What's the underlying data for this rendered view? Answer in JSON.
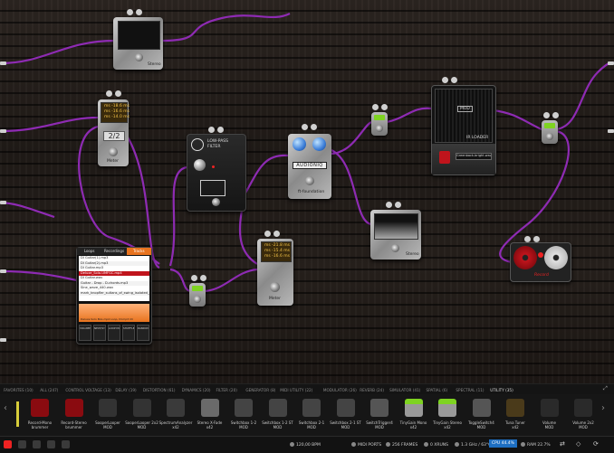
{
  "pedals": {
    "stereo_analyzer_top": {
      "label": "Stereo"
    },
    "metronome_left": {
      "rows": [
        "ms -18.6 ms",
        "ms -16.6 ms",
        "ms -14.0 ms"
      ],
      "big": "2/2",
      "label": "Meter"
    },
    "lowpass": {
      "title_1": "LOW-PASS",
      "title_2": "FILTER",
      "brand": "LPF"
    },
    "fuzz": {
      "label": "AUDIONIQ",
      "sub": "ft-foundation"
    },
    "ir_loader": {
      "brand": "MOD",
      "title": "IR LOADER",
      "file": "Greenback-bright.wav"
    },
    "spectrum_mid": {
      "label": "Stereo"
    },
    "metronome_mid": {
      "rows": [
        "ms -21.8 ms",
        "ms -15.4 ms",
        "ms -16.6 ms"
      ],
      "label": "Meter"
    },
    "looper": {
      "tabs": [
        "Loops",
        "Recordings",
        "Tracks"
      ],
      "files": [
        "DI Guitar(1).mp3",
        "DI Guitar(2).mp3",
        "DI Guitar.mp3",
        "Deluxe_Solo-UMFGC.mp4",
        "DI Guitar.wav",
        "Guitar - Drop - D-chords.mp3",
        "Sine_wave_440.wav",
        "mark_knopfler_sultans_of_swing_isolated_gui"
      ],
      "selected_index": 3,
      "wave_label": "Deluxe Solo BAL.mp4 Loop, DI.mp3 Ch",
      "controls": [
        "VOLUME",
        "NEXT/SYNC",
        "LOOP MODE",
        "SHUFFLE",
        "RANDOM"
      ]
    },
    "reel": {
      "label": "Record"
    }
  },
  "categories": [
    "FAVORITES (10)",
    "ALL (247)",
    "CONTROL VOLTAGE (13)",
    "DELAY (19)",
    "DISTORTION (61)",
    "DYNAMICS (20)",
    "FILTER (20)",
    "GENERATOR (8)",
    "MIDI UTILITY (22)",
    "MODULATOR (26)",
    "REVERB (24)",
    "SIMULATOR (41)",
    "SPATIAL (6)",
    "SPECTRAL (11)",
    "UTILITY (35)"
  ],
  "active_category": "UTILITY (35)",
  "plugins": [
    {
      "name": "Record-Mono",
      "sub": "brummer"
    },
    {
      "name": "Record-Stereo",
      "sub": "brummer"
    },
    {
      "name": "SooperLooper",
      "sub": "MOD"
    },
    {
      "name": "SooperLooper 2x2",
      "sub": "MOD"
    },
    {
      "name": "SpectrumAnalyzer",
      "sub": "x42"
    },
    {
      "name": "Stereo X-Fade",
      "sub": "x42"
    },
    {
      "name": "Switchbox 1-2",
      "sub": "MOD"
    },
    {
      "name": "Switchbox 1-2 ST",
      "sub": "MOD"
    },
    {
      "name": "Switchbox 2-1",
      "sub": "MOD"
    },
    {
      "name": "Switchbox 2-1 ST",
      "sub": "MOD"
    },
    {
      "name": "SwitchTrigger4",
      "sub": "MOD"
    },
    {
      "name": "TinyGain Mono",
      "sub": "x42"
    },
    {
      "name": "TinyGain Stereo",
      "sub": "x42"
    },
    {
      "name": "ToggleSwitch4",
      "sub": "MOD"
    },
    {
      "name": "Tuna Tuner",
      "sub": "x42"
    },
    {
      "name": "Volume",
      "sub": "MOD"
    },
    {
      "name": "Volume 2x2",
      "sub": "MOD"
    }
  ],
  "status": {
    "bpm": "120,00 BPM",
    "midi_ports": "MIDI PORTS",
    "frames": "256 FRAMES",
    "xruns": "0 XRUNS",
    "cpu_freq": "1.3 GHz / 63°C",
    "cpu": "CPU 44.4%",
    "ram": "RAM 22.7%"
  },
  "colors": {
    "cable": "#8e2bb3",
    "accent_green": "#7ed321",
    "looper_orange": "#e8731e",
    "active_red": "#c0141c"
  }
}
